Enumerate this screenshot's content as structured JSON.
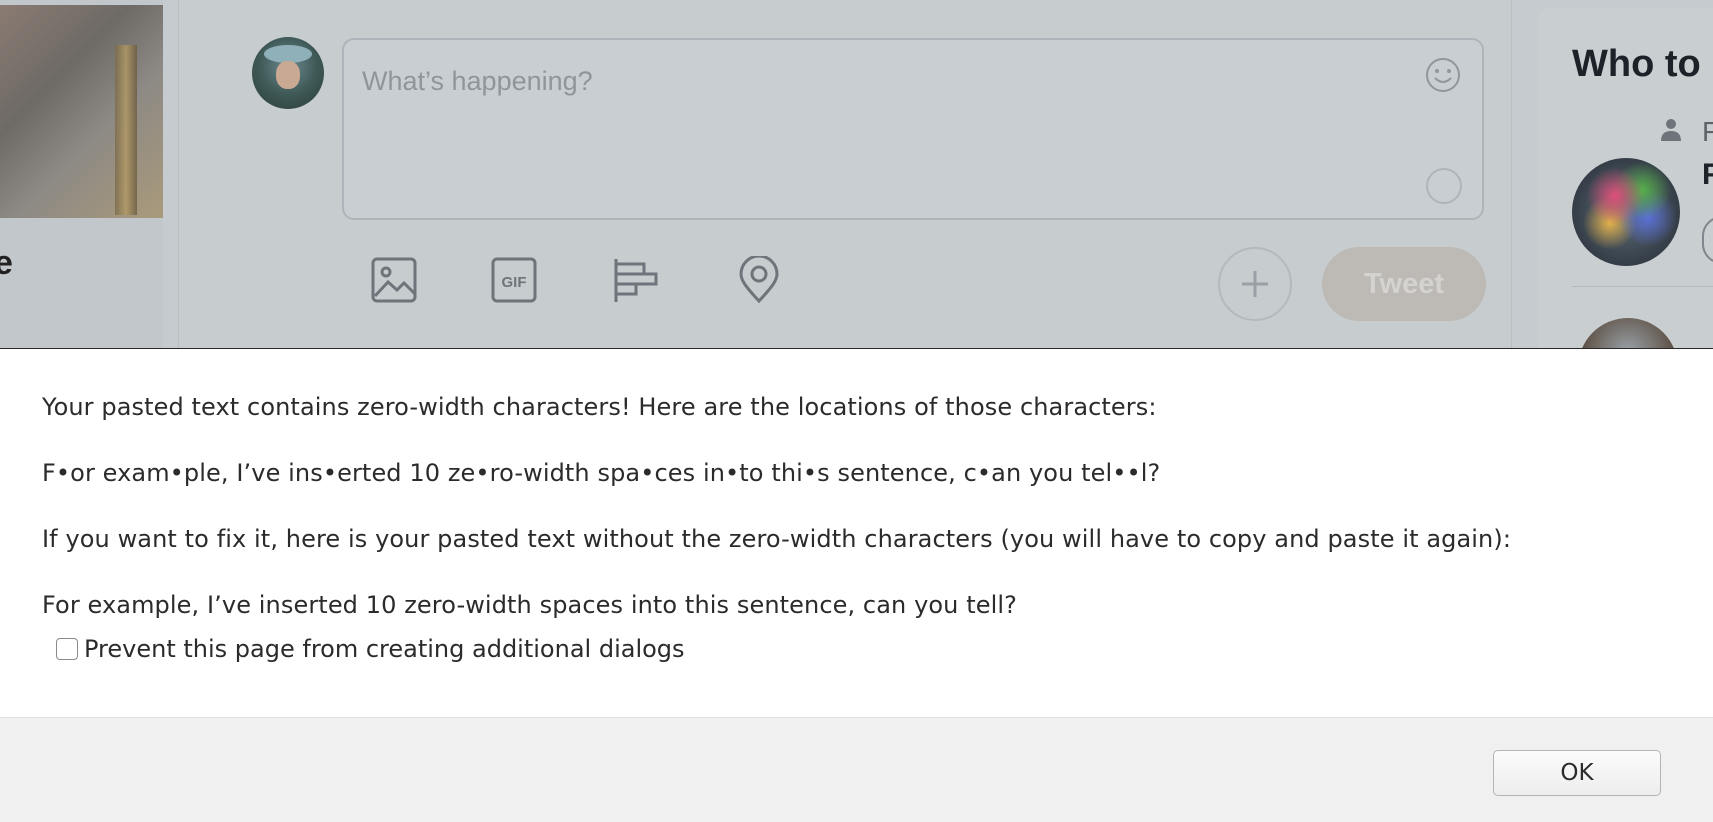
{
  "background": {
    "left_column": {
      "truncated_heading": "e"
    },
    "compose": {
      "placeholder": "What’s happening?",
      "tweet_label": "Tweet",
      "icons": [
        "image-icon",
        "gif-icon",
        "poll-icon",
        "location-icon",
        "emoji-icon",
        "plus-icon"
      ]
    },
    "who_to_follow": {
      "title": "Who to",
      "suggestion_label_truncated": "F",
      "suggestion_name_truncated": "F"
    }
  },
  "dialog": {
    "message_intro": "Your pasted text contains zero-width characters! Here are the locations of those characters:",
    "marked_text": "F•or exam•ple, I’ve ins•erted 10 ze•ro-width spa•ces in•to thi•s sentence, c•an you tel••l?",
    "fix_instruction": "If you want to fix it, here is your pasted text without the zero-width characters (you will have to copy and paste it again):",
    "cleaned_text": "For example, I’ve inserted 10 zero-width spaces into this sentence, can you tell?",
    "checkbox_label": "Prevent this page from creating additional dialogs",
    "checkbox_checked": false,
    "ok_label": "OK"
  }
}
